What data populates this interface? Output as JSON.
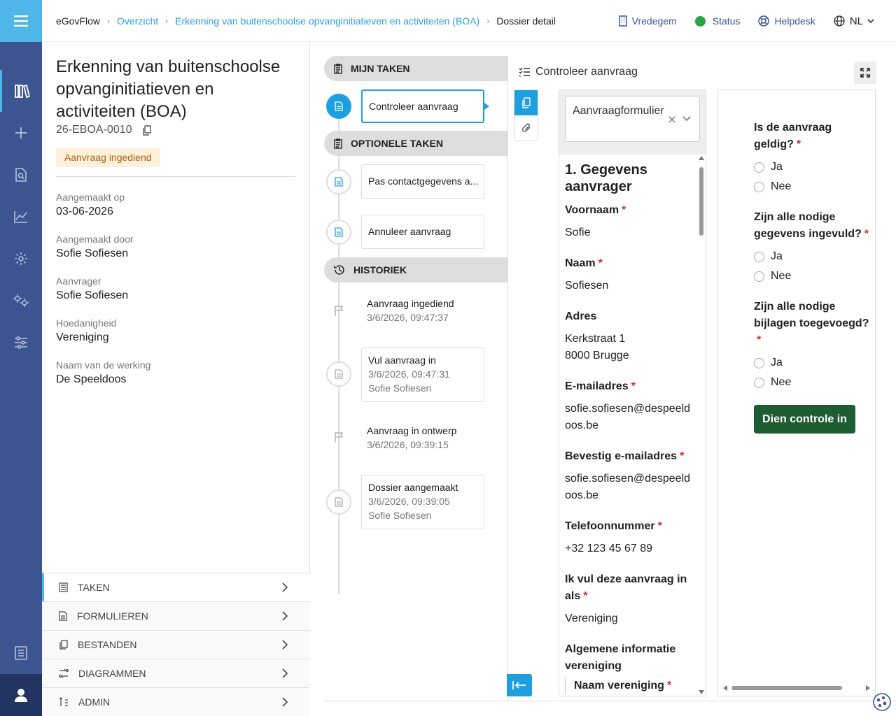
{
  "app": {
    "name": "eGovFlow"
  },
  "breadcrumb": [
    {
      "label": "Overzicht"
    },
    {
      "label": "Erkenning van buitenschoolse opvanginitiatieven en activiteiten (BOA)"
    },
    {
      "label": "Dossier detail"
    }
  ],
  "topbar": {
    "org": "Vredegem",
    "status": "Status",
    "status_color": "#26a641",
    "helpdesk": "Helpdesk",
    "language": "NL"
  },
  "dossier": {
    "title": "Erkenning van buitenschoolse opvanginitiatieven en activiteiten (BOA)",
    "code": "26-EBOA-0010",
    "status_badge": "Aanvraag ingediend",
    "meta": [
      {
        "label": "Aangemaakt op",
        "value": "03-06-2026"
      },
      {
        "label": "Aangemaakt door",
        "value": "Sofie Sofiesen"
      },
      {
        "label": "Aanvrager",
        "value": "Sofie Sofiesen"
      },
      {
        "label": "Hoedanigheid",
        "value": "Vereniging"
      },
      {
        "label": "Naam van de werking",
        "value": "De Speeldoos"
      }
    ]
  },
  "left_nav": [
    {
      "label": "TAKEN",
      "icon": "tasks-icon"
    },
    {
      "label": "FORMULIEREN",
      "icon": "form-icon"
    },
    {
      "label": "BESTANDEN",
      "icon": "files-icon"
    },
    {
      "label": "DIAGRAMMEN",
      "icon": "diagram-icon"
    },
    {
      "label": "ADMIN",
      "icon": "admin-icon"
    }
  ],
  "timeline": {
    "my_tasks_label": "MIJN TAKEN",
    "my_tasks": [
      {
        "label": "Controleer aanvraag"
      }
    ],
    "optional_label": "OPTIONELE TAKEN",
    "optional": [
      {
        "label": "Pas contactgegevens a..."
      },
      {
        "label": "Annuleer aanvraag"
      }
    ],
    "history_label": "HISTORIEK",
    "history": [
      {
        "title": "Aanvraag ingediend",
        "time": "3/6/2026, 09:47:37",
        "user": ""
      },
      {
        "title": "Vul aanvraag in",
        "time": "3/6/2026, 09:47:31",
        "user": "Sofie Sofiesen"
      },
      {
        "title": "Aanvraag in ontwerp",
        "time": "3/6/2026, 09:39:15",
        "user": ""
      },
      {
        "title": "Dossier aangemaakt",
        "time": "3/6/2026, 09:39:05",
        "user": "Sofie Sofiesen"
      }
    ]
  },
  "task_panel": {
    "title": "Controleer aanvraag",
    "form_select": "Aanvraagformulier",
    "section": "1. Gegevens aanvrager",
    "fields": [
      {
        "label": "Voornaam",
        "required": "*",
        "value": "Sofie"
      },
      {
        "label": "Naam",
        "required": "*",
        "value": "Sofiesen"
      },
      {
        "label": "Adres",
        "required": "",
        "value": "Kerkstraat 1",
        "value2": "8000 Brugge"
      },
      {
        "label": "E-mailadres",
        "required": "*",
        "value": "sofie.sofiesen@despeeldoos.be"
      },
      {
        "label": "Bevestig e-mailadres",
        "required": "*",
        "value": "sofie.sofiesen@despeeldoos.be"
      },
      {
        "label": "Telefoonnummer",
        "required": "*",
        "value": "+32 123 45 67 89"
      },
      {
        "label": "Ik vul deze aanvraag in als",
        "required": "*",
        "value": "Vereniging"
      },
      {
        "label": "Algemene informatie vereniging",
        "required": "",
        "value": ""
      },
      {
        "label": "Naam vereniging",
        "required": "*",
        "value": ""
      }
    ],
    "questions": [
      {
        "label": "Is de aanvraag geldig?",
        "required": "*",
        "options": [
          "Ja",
          "Nee"
        ]
      },
      {
        "label": "Zijn alle nodige gegevens ingevuld?",
        "required": "*",
        "options": [
          "Ja",
          "Nee"
        ]
      },
      {
        "label": "Zijn alle nodige bijlagen toegevoegd?",
        "required": "*",
        "options": [
          "Ja",
          "Nee"
        ]
      }
    ],
    "submit": "Dien controle in"
  }
}
